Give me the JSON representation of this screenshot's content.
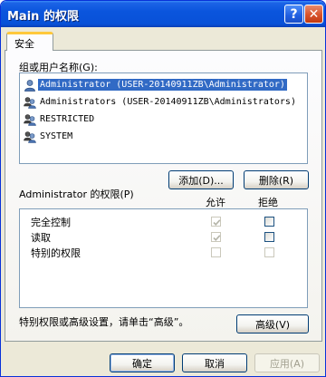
{
  "window": {
    "title": "Main 的权限",
    "help_label": "?",
    "close_label": "✕"
  },
  "tabs": [
    {
      "label": "安全",
      "selected": true
    }
  ],
  "users_section": {
    "label": "组或用户名称(G):",
    "items": [
      {
        "name": "Administrator (USER-20140911ZB\\Administrator)",
        "icon": "single-user-icon",
        "selected": true
      },
      {
        "name": "Administrators (USER-20140911ZB\\Administrators)",
        "icon": "user-group-icon",
        "selected": false
      },
      {
        "name": "RESTRICTED",
        "icon": "user-group-icon",
        "selected": false
      },
      {
        "name": "SYSTEM",
        "icon": "user-group-icon",
        "selected": false
      }
    ],
    "add_label": "添加(D)...",
    "remove_label": "删除(R)"
  },
  "permissions": {
    "label": "Administrator 的权限(P)",
    "allow_header": "允许",
    "deny_header": "拒绝",
    "rows": [
      {
        "name": "完全控制",
        "allow": true,
        "allow_disabled": true,
        "deny": false,
        "deny_disabled": false
      },
      {
        "name": "读取",
        "allow": true,
        "allow_disabled": true,
        "deny": false,
        "deny_disabled": false
      },
      {
        "name": "特别的权限",
        "allow": false,
        "allow_disabled": true,
        "deny": false,
        "deny_disabled": true
      }
    ]
  },
  "advanced": {
    "hint": "特别权限或高级设置，请单击“高级”。",
    "button_label": "高级(V)"
  },
  "footer": {
    "ok_label": "确定",
    "cancel_label": "取消",
    "apply_label": "应用(A)",
    "apply_disabled": true
  },
  "colors": {
    "titlebar": "#0a55dd",
    "selection": "#316ac5",
    "tab_highlight": "#ffc83c",
    "button_border": "#003c74",
    "check_disabled": "#b4b4a8"
  }
}
